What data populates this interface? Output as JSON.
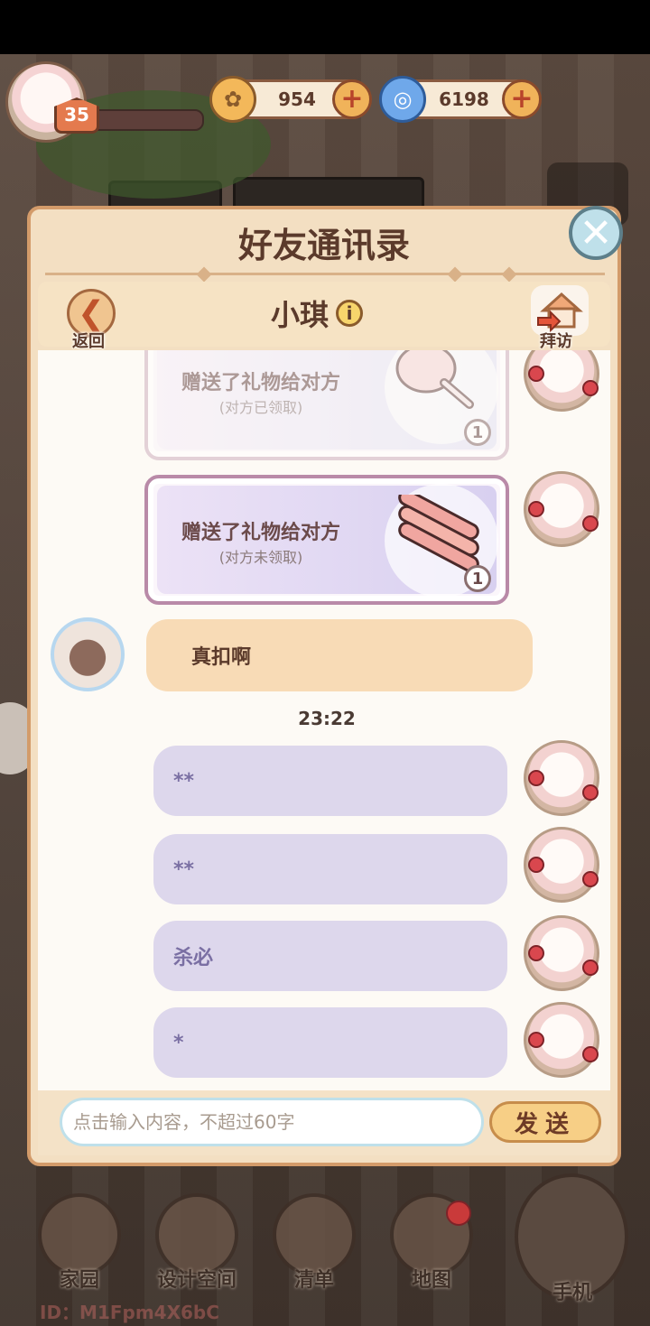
{
  "hud": {
    "level": "35",
    "xp_progress": 0.05,
    "coins": "954",
    "gems": "6198",
    "coin_plus": "+",
    "gem_plus": "+"
  },
  "dialog": {
    "title": "好友通讯录",
    "close_symbol": "✕",
    "back_label": "返回",
    "back_symbol": "❮",
    "friend_name": "小琪",
    "info_symbol": "i",
    "visit_label": "拜访"
  },
  "messages": {
    "gift1": {
      "title": "赠送了礼物给对方",
      "status": "(对方已领取)",
      "count": "1"
    },
    "gift2": {
      "title": "赠送了礼物给对方",
      "status": "(对方未领取)",
      "count": "1"
    },
    "friend_msg": "真扣啊",
    "timestamp": "23:22",
    "mine": [
      "**",
      "**",
      "杀必",
      "*"
    ]
  },
  "input": {
    "placeholder": "点击输入内容，不超过60字",
    "send_label": "发送"
  },
  "nav": {
    "home": "家园",
    "design": "设计空间",
    "list": "清单",
    "map": "地图",
    "phone": "手机"
  },
  "footer": {
    "id_text": "ID：M1Fpm4X6bC"
  }
}
